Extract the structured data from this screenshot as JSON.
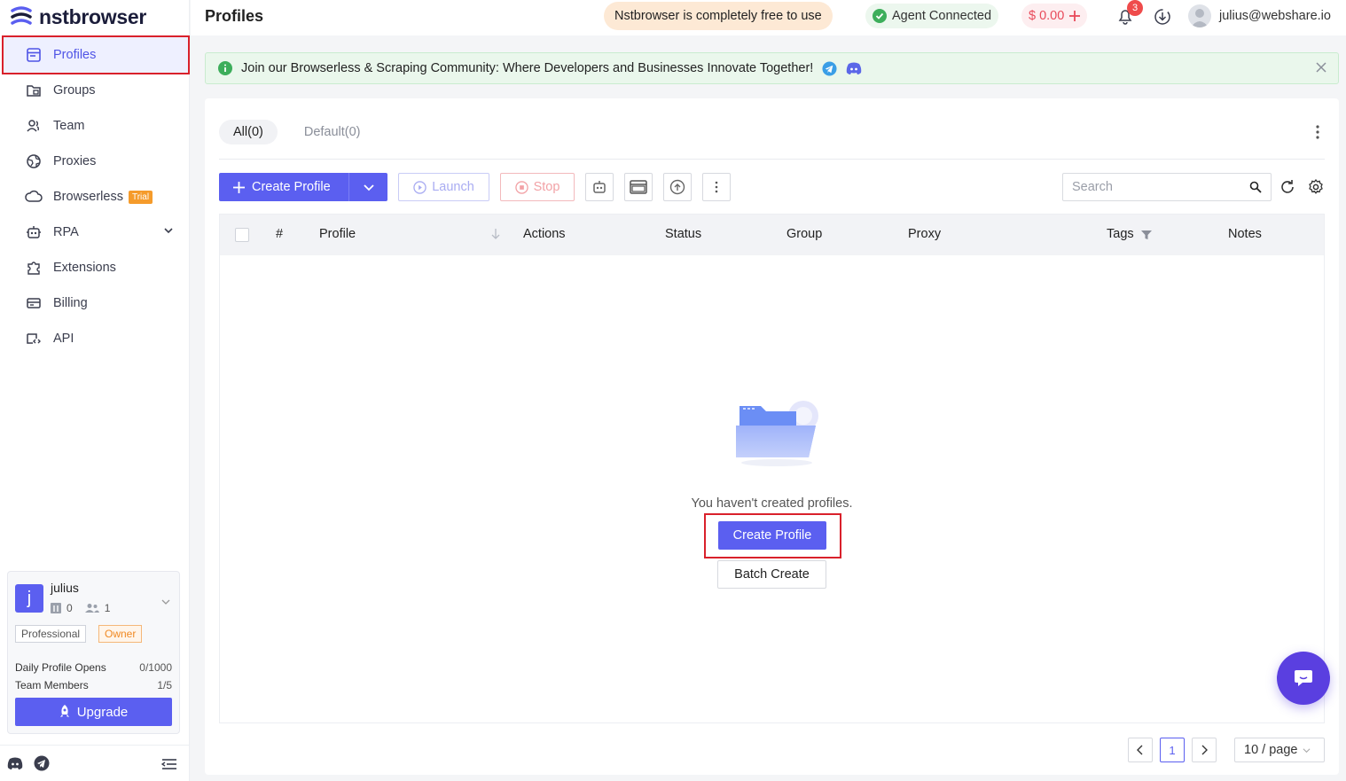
{
  "app": {
    "brand": "nstbrowser",
    "page_title": "Profiles"
  },
  "sidebar": {
    "items": [
      {
        "label": "Profiles",
        "icon": "profiles-icon"
      },
      {
        "label": "Groups",
        "icon": "groups-icon"
      },
      {
        "label": "Team",
        "icon": "team-icon"
      },
      {
        "label": "Proxies",
        "icon": "proxies-icon"
      },
      {
        "label": "Browserless",
        "icon": "cloud-icon",
        "badge": "Trial"
      },
      {
        "label": "RPA",
        "icon": "robot-icon"
      },
      {
        "label": "Extensions",
        "icon": "puzzle-icon"
      },
      {
        "label": "Billing",
        "icon": "billing-icon"
      },
      {
        "label": "API",
        "icon": "api-icon"
      }
    ]
  },
  "user_card": {
    "initial": "j",
    "name": "julius",
    "profiles_count": "0",
    "members_count": "1",
    "plan": "Professional",
    "role": "Owner",
    "daily_opens_label": "Daily Profile Opens",
    "daily_opens_value": "0/1000",
    "team_members_label": "Team Members",
    "team_members_value": "1/5",
    "upgrade_label": "Upgrade"
  },
  "topbar": {
    "free_text": "Nstbrowser is completely free to use",
    "agent_text": "Agent Connected",
    "balance": "$ 0.00",
    "notifications": "3",
    "email": "julius@webshare.io"
  },
  "banner": {
    "text": "Join our Browserless & Scraping Community: Where Developers and Businesses Innovate Together!"
  },
  "tabs": [
    {
      "label": "All(0)"
    },
    {
      "label": "Default(0)"
    }
  ],
  "toolbar": {
    "create_label": "Create Profile",
    "launch_label": "Launch",
    "stop_label": "Stop",
    "search_placeholder": "Search"
  },
  "table": {
    "columns": [
      "#",
      "Profile",
      "Actions",
      "Status",
      "Group",
      "Proxy",
      "Tags",
      "Notes"
    ]
  },
  "empty_state": {
    "message": "You haven't created profiles.",
    "create_label": "Create Profile",
    "batch_label": "Batch Create"
  },
  "pagination": {
    "current_page": "1",
    "page_size": "10 / page"
  },
  "colors": {
    "accent": "#5b5ff0",
    "highlight": "#d9212b",
    "trial": "#f59b2b"
  }
}
